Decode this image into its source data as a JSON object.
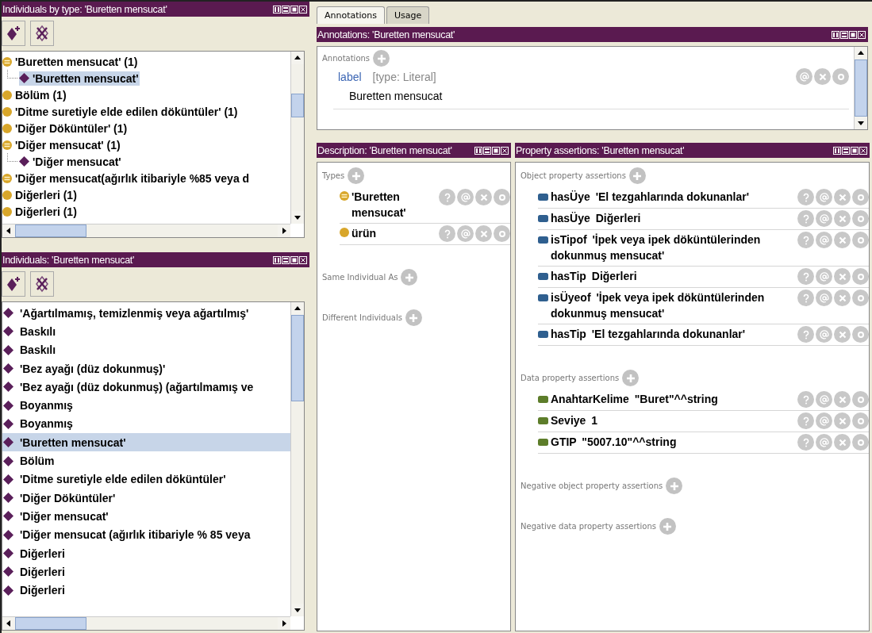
{
  "individuals_by_type": {
    "title": "Individuals by type: 'Buretten mensucat'",
    "items": [
      {
        "label": "'Buretten mensucat' (1)",
        "kind": "defined_class",
        "selected": false,
        "children": [
          {
            "label": "'Buretten mensucat'",
            "kind": "individual",
            "selected": true
          }
        ]
      },
      {
        "label": "Bölüm (1)",
        "kind": "class",
        "selected": false
      },
      {
        "label": "'Ditme suretiyle elde edilen döküntüler' (1)",
        "kind": "class",
        "selected": false
      },
      {
        "label": "'Diğer Döküntüler' (1)",
        "kind": "class",
        "selected": false
      },
      {
        "label": "'Diğer mensucat' (1)",
        "kind": "defined_class",
        "selected": false,
        "children": [
          {
            "label": "'Diğer mensucat'",
            "kind": "individual",
            "selected": false
          }
        ]
      },
      {
        "label": "'Diğer mensucat(ağırlık itibariyle %85 veya d",
        "kind": "defined_class",
        "selected": false
      },
      {
        "label": "Diğerleri (1)",
        "kind": "class",
        "selected": false
      },
      {
        "label": "Diğerleri (1)",
        "kind": "class",
        "selected": false
      }
    ]
  },
  "individuals": {
    "title": "Individuals: 'Buretten mensucat'",
    "items": [
      {
        "label": "'Ağartılmamış, temizlenmiş veya ağartılmış'",
        "selected": false
      },
      {
        "label": "Baskılı",
        "selected": false
      },
      {
        "label": "Baskılı",
        "selected": false
      },
      {
        "label": "'Bez ayağı (düz dokunmuş)'",
        "selected": false
      },
      {
        "label": "'Bez ayağı (düz dokunmuş) (ağartılmamış ve",
        "selected": false
      },
      {
        "label": "Boyanmış",
        "selected": false
      },
      {
        "label": "Boyanmış",
        "selected": false
      },
      {
        "label": "'Buretten mensucat'",
        "selected": true
      },
      {
        "label": "Bölüm",
        "selected": false
      },
      {
        "label": "'Ditme suretiyle elde edilen döküntüler'",
        "selected": false
      },
      {
        "label": "'Diğer Döküntüler'",
        "selected": false
      },
      {
        "label": "'Diğer mensucat'",
        "selected": false
      },
      {
        "label": "'Diğer mensucat (ağırlık itibariyle % 85 veya",
        "selected": false
      },
      {
        "label": "Diğerleri",
        "selected": false
      },
      {
        "label": "Diğerleri",
        "selected": false
      },
      {
        "label": "Diğerleri",
        "selected": false
      }
    ]
  },
  "tabs": [
    {
      "label": "Annotations",
      "selected": true
    },
    {
      "label": "Usage",
      "selected": false
    }
  ],
  "annotations": {
    "title": "Annotations: 'Buretten mensucat'",
    "section": "Annotations",
    "items": [
      {
        "property": "label",
        "type": "[type: Literal]",
        "value": "Buretten mensucat"
      }
    ]
  },
  "description": {
    "title": "Description: 'Buretten mensucat'",
    "sections": [
      {
        "heading": "Types",
        "items": [
          {
            "label": "'Buretten mensucat'",
            "kind": "defined_class"
          },
          {
            "label": "ürün",
            "kind": "class"
          }
        ]
      },
      {
        "heading": "Same Individual As"
      },
      {
        "heading": "Different Individuals"
      }
    ]
  },
  "property_assertions": {
    "title": "Property assertions: 'Buretten mensucat'",
    "sections": [
      {
        "heading": "Object property assertions",
        "kind": "object",
        "items": [
          {
            "property": "hasÜye",
            "value": "'El tezgahlarında dokunanlar'"
          },
          {
            "property": "hasÜye",
            "value": "Diğerleri"
          },
          {
            "property": "isTipof",
            "value": "'İpek veya ipek döküntülerinden dokunmuş mensucat'"
          },
          {
            "property": "hasTip",
            "value": "Diğerleri"
          },
          {
            "property": "isÜyeof",
            "value": "'İpek veya ipek döküntülerinden dokunmuş mensucat'"
          },
          {
            "property": "hasTip",
            "value": "'El tezgahlarında dokunanlar'"
          }
        ]
      },
      {
        "heading": "Data property assertions",
        "kind": "data",
        "items": [
          {
            "property": "AnahtarKelime",
            "value": "\"Buret\"^^string"
          },
          {
            "property": "Seviye",
            "value": "1"
          },
          {
            "property": "GTIP",
            "value": "\"5007.10\"^^string"
          }
        ]
      },
      {
        "heading": "Negative object property assertions"
      },
      {
        "heading": "Negative data property assertions"
      }
    ]
  }
}
